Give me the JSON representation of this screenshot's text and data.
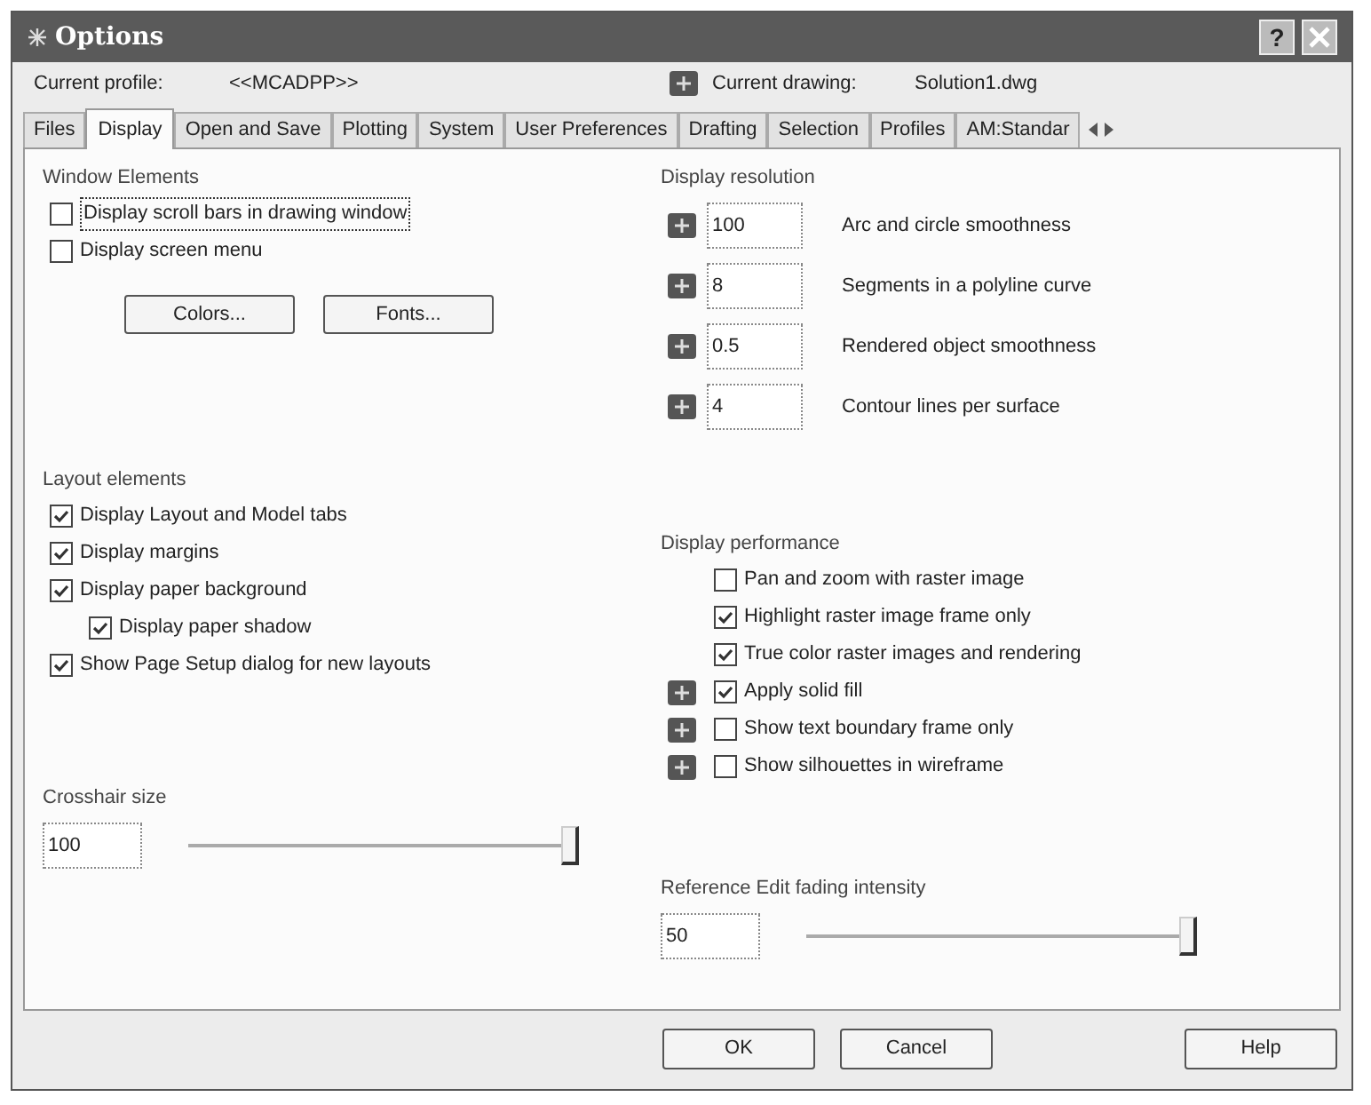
{
  "window": {
    "title": "Options",
    "help": "?"
  },
  "profile": {
    "label": "Current profile:",
    "value": "<<MCADPP>>"
  },
  "drawing": {
    "label": "Current drawing:",
    "value": "Solution1.dwg"
  },
  "tabs": [
    {
      "label": "Files",
      "selected": false
    },
    {
      "label": "Display",
      "selected": true
    },
    {
      "label": "Open and Save",
      "selected": false
    },
    {
      "label": "Plotting",
      "selected": false
    },
    {
      "label": "System",
      "selected": false
    },
    {
      "label": "User Preferences",
      "selected": false
    },
    {
      "label": "Drafting",
      "selected": false
    },
    {
      "label": "Selection",
      "selected": false
    },
    {
      "label": "Profiles",
      "selected": false
    },
    {
      "label": "AM:Standar",
      "selected": false
    }
  ],
  "window_elements": {
    "title": "Window Elements",
    "checkboxes": [
      {
        "label": "Display scroll bars in drawing window",
        "checked": false,
        "focused": true
      },
      {
        "label": "Display screen menu",
        "checked": false,
        "focused": false
      }
    ],
    "buttons": [
      "Colors...",
      "Fonts..."
    ]
  },
  "display_resolution": {
    "title": "Display resolution",
    "rows": [
      {
        "value": "100",
        "label": "Arc and circle smoothness"
      },
      {
        "value": "8",
        "label": "Segments in a polyline curve"
      },
      {
        "value": "0.5",
        "label": "Rendered object smoothness"
      },
      {
        "value": "4",
        "label": "Contour lines per surface"
      }
    ]
  },
  "layout_elements": {
    "title": "Layout elements",
    "checkboxes": [
      {
        "label": "Display Layout and Model tabs",
        "checked": true
      },
      {
        "label": "Display margins",
        "checked": true
      },
      {
        "label": "Display paper background",
        "checked": true,
        "children": [
          {
            "label": "Display paper shadow",
            "checked": true
          }
        ]
      },
      {
        "label": "Show Page Setup dialog for new layouts",
        "checked": true
      }
    ]
  },
  "display_performance": {
    "title": "Display performance",
    "checkboxes": [
      {
        "label": "Pan and zoom with raster image",
        "checked": false,
        "saved_in_drawing": false
      },
      {
        "label": "Highlight raster image frame only",
        "checked": true,
        "saved_in_drawing": false
      },
      {
        "label": "True color raster images and rendering",
        "checked": true,
        "saved_in_drawing": false
      },
      {
        "label": "Apply solid fill",
        "checked": true,
        "saved_in_drawing": true
      },
      {
        "label": "Show text boundary frame only",
        "checked": false,
        "saved_in_drawing": true
      },
      {
        "label": "Show silhouettes in wireframe",
        "checked": false,
        "saved_in_drawing": true
      }
    ]
  },
  "crosshair": {
    "title": "Crosshair size",
    "value": "100",
    "level": 1
  },
  "fading": {
    "title": "Reference Edit fading intensity",
    "value": "50",
    "level": 1
  },
  "buttons": [
    "OK",
    "Cancel",
    "Help"
  ]
}
